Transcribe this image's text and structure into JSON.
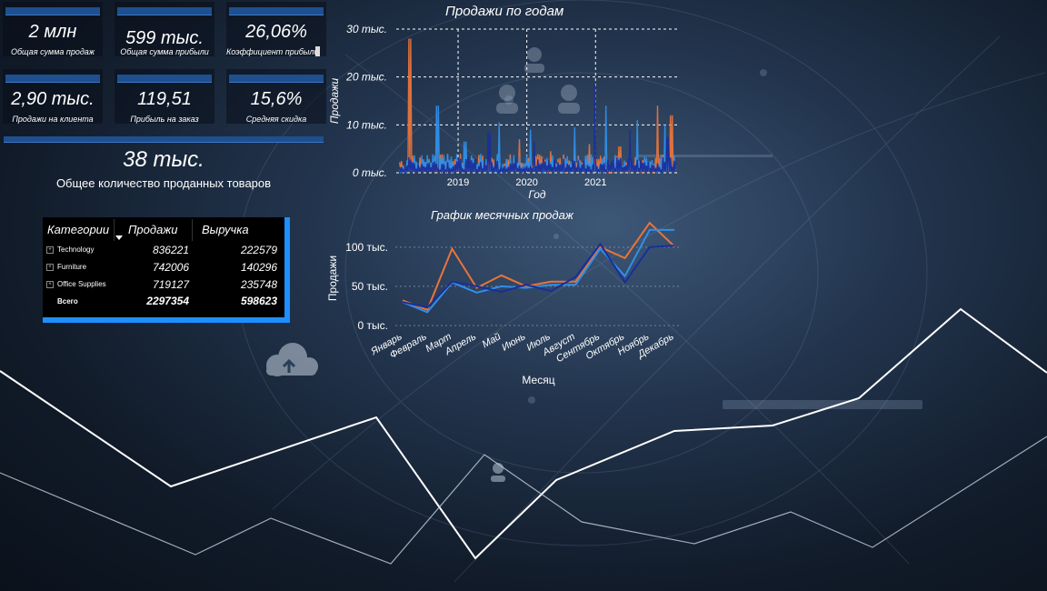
{
  "kpis": [
    {
      "value": "2 млн",
      "label": "Общая сумма продаж"
    },
    {
      "value": "599 тыс.",
      "label": "Общая сумма прибыли"
    },
    {
      "value": "26,06%",
      "label": "Коэффициент прибыли"
    },
    {
      "value": "2,90 тыс.",
      "label": "Продажи на клиента"
    },
    {
      "value": "119,51",
      "label": "Прибыль на заказ"
    },
    {
      "value": "15,6%",
      "label": "Средняя скидка"
    }
  ],
  "total_items": {
    "value": "38 тыс.",
    "label": "Общее количество проданных товаров"
  },
  "table": {
    "headers": [
      "Категории",
      "Продажи",
      "Выручка"
    ],
    "rows": [
      {
        "category": "Technology",
        "sales": "836221",
        "revenue": "222579"
      },
      {
        "category": "Furniture",
        "sales": "742006",
        "revenue": "140296"
      },
      {
        "category": "Office Supplies",
        "sales": "719127",
        "revenue": "235748"
      }
    ],
    "total": {
      "label": "Всего",
      "sales": "2297354",
      "revenue": "598623"
    }
  },
  "colors": {
    "orange": "#e8743b",
    "blue": "#2f8fe8",
    "navy": "#1a2e9a",
    "accent": "#1e8fff"
  },
  "chart_data": [
    {
      "type": "bar",
      "title": "Продажи по годам",
      "xlabel": "Год",
      "ylabel": "Продажи",
      "ytick_labels": [
        "0 тыс.",
        "10 тыс.",
        "20 тыс.",
        "30 тыс."
      ],
      "xtick_labels": [
        "2019",
        "2020",
        "2021"
      ],
      "ylim": [
        0,
        30000
      ],
      "xlim": [
        2018.1,
        2022.2
      ],
      "grid": true,
      "series": [
        {
          "color": "#e8743b",
          "peaks": [
            [
              2018.3,
              28000
            ],
            [
              2019.9,
              7000
            ],
            [
              2020.35,
              4500
            ],
            [
              2020.9,
              6000
            ],
            [
              2021.35,
              5500
            ],
            [
              2021.9,
              14000
            ],
            [
              2022.1,
              12000
            ]
          ]
        },
        {
          "color": "#2f8fe8",
          "peaks": [
            [
              2018.7,
              14000
            ],
            [
              2019.1,
              6500
            ],
            [
              2019.6,
              10500
            ],
            [
              2020.05,
              9000
            ],
            [
              2020.7,
              9500
            ],
            [
              2021.15,
              14000
            ],
            [
              2021.6,
              11000
            ],
            [
              2022.0,
              10000
            ]
          ]
        },
        {
          "color": "#1a2e9a",
          "peaks": [
            [
              2019.45,
              8500
            ],
            [
              2020.1,
              6500
            ],
            [
              2021.0,
              18500
            ],
            [
              2021.5,
              9000
            ],
            [
              2022.05,
              7500
            ]
          ]
        }
      ]
    },
    {
      "type": "line",
      "title": "График месячных продаж",
      "xlabel": "Месяц",
      "ylabel": "Продажи",
      "categories": [
        "Январь",
        "Февраль",
        "Март",
        "Апрель",
        "Май",
        "Июнь",
        "Июль",
        "Август",
        "Сентябрь",
        "Октябрь",
        "Ноябрь",
        "Декабрь"
      ],
      "ytick_labels": [
        "0 тыс.",
        "50 тыс.",
        "100 тыс."
      ],
      "ylim": [
        0,
        130000
      ],
      "grid": true,
      "series": [
        {
          "color": "#e8743b",
          "values": [
            32000,
            20000,
            98000,
            48000,
            64000,
            50000,
            56000,
            56000,
            100000,
            86000,
            131000,
            101000
          ]
        },
        {
          "color": "#2f8fe8",
          "values": [
            30000,
            17000,
            55000,
            42000,
            50000,
            48000,
            52000,
            52000,
            98000,
            63000,
            122000,
            122000
          ]
        },
        {
          "color": "#1a2e9a",
          "values": [
            30000,
            23000,
            56000,
            50000,
            43000,
            52000,
            44000,
            62000,
            104000,
            55000,
            100000,
            102000
          ]
        }
      ]
    }
  ]
}
